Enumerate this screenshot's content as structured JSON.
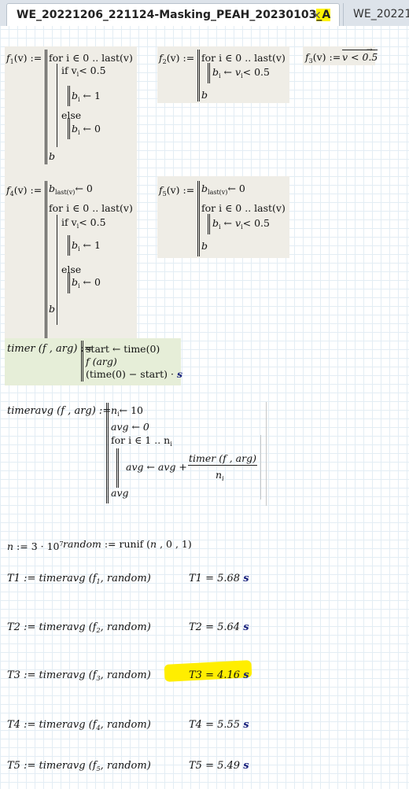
{
  "tabs": [
    {
      "label": "WE_20221206_221124-Masking_PEAH_20230103_A",
      "close": "×"
    },
    {
      "label": "WE_202212"
    }
  ],
  "f1": {
    "head": "f",
    "sub": "1",
    "args": "(v) :=",
    "for": "for i ∈ 0 .. last(v)",
    "if": "if v",
    "if_sub": "i",
    "if_tail": "< 0.5",
    "assign1": "b ← 1",
    "assign1_sub": "i",
    "else": "else",
    "assign0": "b ← 0",
    "assign0_sub": "i",
    "ret": "b"
  },
  "f2": {
    "head": "f",
    "sub": "2",
    "args": "(v) :=",
    "for": "for i ∈ 0 .. last(v)",
    "assign": "b ← v",
    "assign_sub1": "i",
    "assign_sub2": "i",
    "assign_tail": "< 0.5",
    "ret": "b"
  },
  "f3": {
    "head": "f",
    "sub": "3",
    "args": "(v) :=",
    "body": "v < 0.5"
  },
  "f4": {
    "head": "f",
    "sub": "4",
    "args": "(v) :=",
    "init": "b",
    "init_sub": "last(v)",
    "init_tail": "← 0",
    "for": "for i ∈ 0 .. last(v)",
    "if": "if v",
    "if_sub": "i",
    "if_tail": "< 0.5",
    "assign1": "b ← 1",
    "assign1_sub": "i",
    "else": "else",
    "assign0": "b ← 0",
    "assign0_sub": "i",
    "ret": "b"
  },
  "f5": {
    "head": "f",
    "sub": "5",
    "args": "(v) :=",
    "init": "b",
    "init_sub": "last(v)",
    "init_tail": "← 0",
    "for": "for i ∈ 0 .. last(v)",
    "assign": "b ← v",
    "assign_sub1": "i",
    "assign_sub2": "i",
    "assign_tail": "< 0.5",
    "ret": "b"
  },
  "timer": {
    "def": "timer (f , arg) :=",
    "l1": "start ← time(0)",
    "l2": "f (arg)",
    "l3": "(time(0) − start) ·",
    "unit": "s"
  },
  "timeravg": {
    "def": "timeravg (f , arg) :=",
    "l1a": "n",
    "l1s": "i",
    "l1b": "← 10",
    "l2": "avg ← 0",
    "l3a": "for i ∈ 1 .. n",
    "l3s": "i",
    "l4": "avg ← avg +",
    "num": "timer (f , arg)",
    "den": "n",
    "den_sub": "i",
    "ret": "avg"
  },
  "params": {
    "n": "n := 3 · 10",
    "n_exp": "7",
    "random": "random := runif (n , 0 , 1)"
  },
  "results": [
    {
      "def": "T1 := timeravg (f",
      "sub": "1",
      "tail": ", random)",
      "val": "T1 = 5.68",
      "unit": "s"
    },
    {
      "def": "T2 := timeravg (f",
      "sub": "2",
      "tail": ", random)",
      "val": "T2 = 5.64",
      "unit": "s"
    },
    {
      "def": "T3 := timeravg (f",
      "sub": "3",
      "tail": ", random)",
      "val": "T3 = 4.16",
      "unit": "s"
    },
    {
      "def": "T4 := timeravg (f",
      "sub": "4",
      "tail": ", random)",
      "val": "T4 = 5.55",
      "unit": "s"
    },
    {
      "def": "T5 := timeravg (f",
      "sub": "5",
      "tail": ", random)",
      "val": "T5 = 5.49",
      "unit": "s"
    }
  ],
  "colors": {
    "highlight": "#fff200",
    "region": "#efede6",
    "region_green": "#e6eed8",
    "unit": "#1a237e",
    "grid": "#e3edf4"
  }
}
